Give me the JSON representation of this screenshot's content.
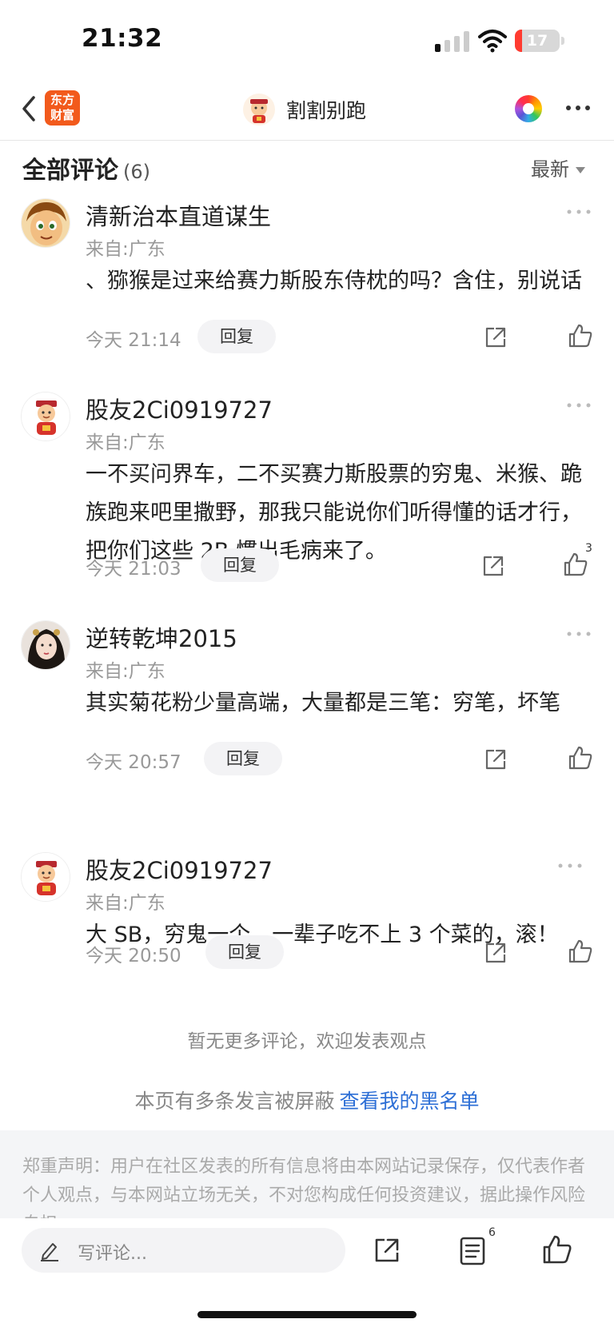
{
  "status_bar": {
    "time": "21:32",
    "battery": "17"
  },
  "nav": {
    "logo_line1": "东方",
    "logo_line2": "财富",
    "title": "割割别跑"
  },
  "section": {
    "title": "全部评论",
    "count": "(6)",
    "sort_label": "最新"
  },
  "comments": [
    {
      "name": "清新治本直道谋生",
      "source": "来自:广东",
      "body": "、猕猴是过来给赛力斯股东侍枕的吗？含住，别说话",
      "time": "今天 21:14",
      "reply_label": "回复",
      "likes": ""
    },
    {
      "name": "股友2Ci0919727",
      "source": "来自:广东",
      "body": "一不买问界车，二不买赛力斯股票的穷鬼、米猴、跪族跑来吧里撒野，那我只能说你们听得懂的话才行，把你们这些 2B 惯出毛病来了。",
      "time": "今天 21:03",
      "reply_label": "回复",
      "likes": "3"
    },
    {
      "name": "逆转乾坤2015",
      "source": "来自:广东",
      "body": "其实菊花粉少量高端，大量都是三笔：穷笔，坏笔",
      "time": "今天 20:57",
      "reply_label": "回复",
      "likes": ""
    },
    {
      "name": "股友2Ci0919727",
      "source": "来自:广东",
      "body": "大 SB，穷鬼一个，一辈子吃不上 3 个菜的，滚！",
      "time": "今天 20:50",
      "reply_label": "回复",
      "likes": ""
    }
  ],
  "footer": {
    "no_more": "暂无更多评论，欢迎发表观点",
    "blocked_text": "本页有多条发言被屏蔽",
    "blacklist_link": "查看我的黑名单",
    "disclaimer": "郑重声明：用户在社区发表的所有信息将由本网站记录保存，仅代表作者个人观点，与本网站立场无关，不对您构成任何投资建议，据此操作风险自担。"
  },
  "bottom_bar": {
    "write_placeholder": "写评论...",
    "list_count": "6"
  },
  "colors": {
    "brand": "#f25a1c",
    "link": "#2d6fd6",
    "battery_low": "#ff3b30"
  }
}
